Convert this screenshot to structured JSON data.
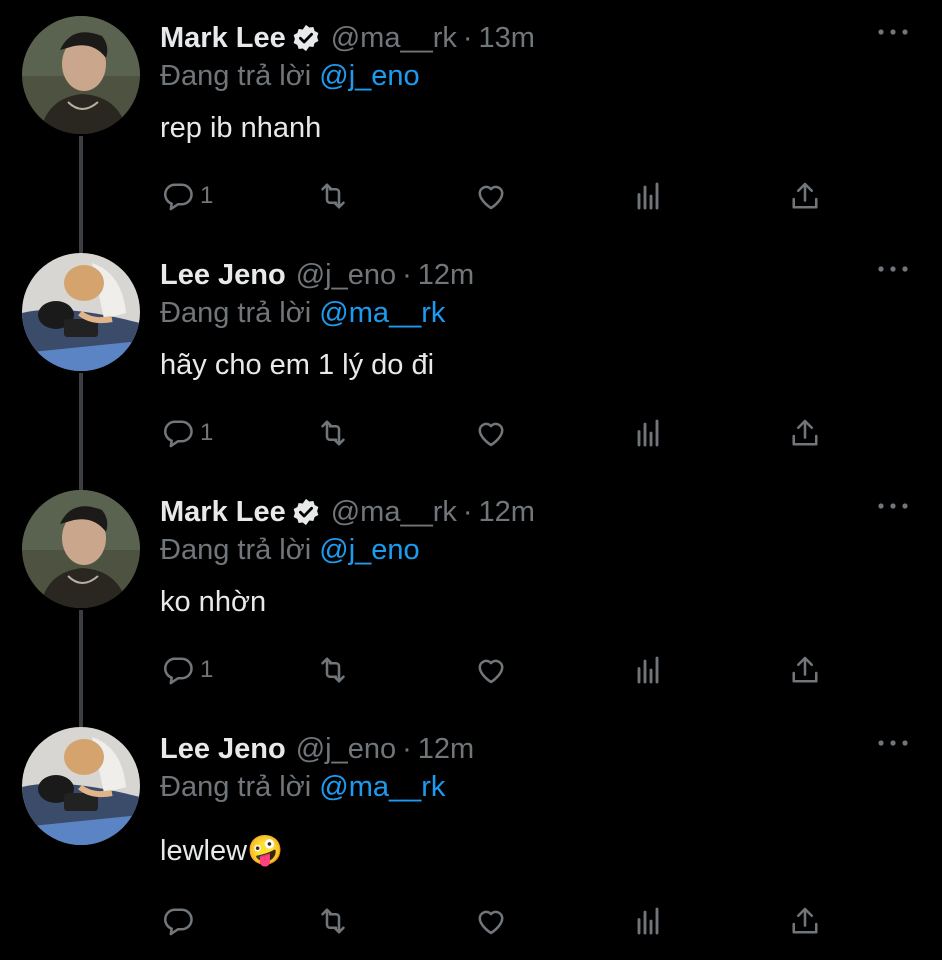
{
  "tweets": [
    {
      "name": "Mark Lee",
      "verified": true,
      "handle": "@ma__rk",
      "separator": "·",
      "time": "13m",
      "reply_prefix": "Đang trả lời",
      "reply_to": "@j_eno",
      "text": "rep ib nhanh",
      "reply_count": "1"
    },
    {
      "name": "Lee Jeno",
      "verified": false,
      "handle": "@j_eno",
      "separator": "·",
      "time": "12m",
      "reply_prefix": "Đang trả lời",
      "reply_to": "@ma__rk",
      "text": "hãy cho em 1 lý do đi",
      "reply_count": "1"
    },
    {
      "name": "Mark Lee",
      "verified": true,
      "handle": "@ma__rk",
      "separator": "·",
      "time": "12m",
      "reply_prefix": "Đang trả lời",
      "reply_to": "@j_eno",
      "text": "ko nhờn",
      "reply_count": "1"
    },
    {
      "name": "Lee Jeno",
      "verified": false,
      "handle": "@j_eno",
      "separator": "·",
      "time": "12m",
      "reply_prefix": "Đang trả lời",
      "reply_to": "@ma__rk",
      "text": "lewlew🤪",
      "reply_count": ""
    }
  ],
  "colors": {
    "background": "#000000",
    "text_primary": "#e7e9ea",
    "text_secondary": "#71767b",
    "accent": "#1d9bf0",
    "thread_line": "#3b3f44"
  },
  "icons": {
    "reply": "comment-icon",
    "retweet": "retweet-icon",
    "like": "heart-icon",
    "stats": "bar-chart-icon",
    "share": "share-icon",
    "more": "more-options-icon",
    "verified": "verified-badge-icon"
  }
}
